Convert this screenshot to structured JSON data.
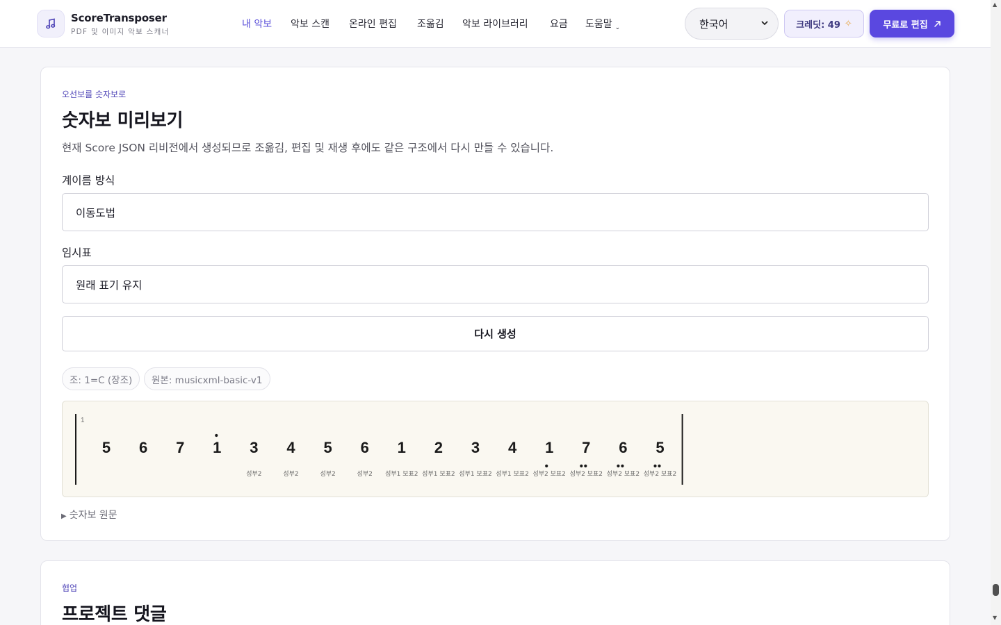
{
  "header": {
    "brand_name": "ScoreTransposer",
    "brand_sub": "PDF 및 이미지 악보 스캐너",
    "nav": [
      {
        "label": "내 악보",
        "active": true
      },
      {
        "label": "악보 스캔",
        "active": false
      },
      {
        "label": "온라인 편집",
        "active": false
      },
      {
        "label": "조옮김",
        "active": false
      },
      {
        "label": "악보 라이브러리",
        "active": false
      },
      {
        "label": "요금",
        "active": false
      },
      {
        "label": "도움말",
        "active": false
      }
    ],
    "language": "한국어",
    "credits_label": "크레딧: 49",
    "cta_label": "무료로 편집"
  },
  "preview": {
    "eyebrow": "오선보를 숫자보로",
    "title": "숫자보 미리보기",
    "description": "현재 Score JSON 리비전에서 생성되므로 조옮김, 편집 및 재생 후에도 같은 구조에서 다시 만들 수 있습니다.",
    "solfege_label": "계이름 방식",
    "solfege_value": "이동도법",
    "accidental_label": "임시표",
    "accidental_value": "원래 표기 유지",
    "regenerate_label": "다시 생성",
    "key_chip": "조: 1=C (장조)",
    "source_chip": "원본: musicxml-basic-v1",
    "details_label": "숫자보 원문"
  },
  "score": {
    "measure_number": "1",
    "notes": [
      {
        "digit": "5",
        "lyric": "",
        "dots_above": 0,
        "dots_below": 0
      },
      {
        "digit": "6",
        "lyric": "",
        "dots_above": 0,
        "dots_below": 0
      },
      {
        "digit": "7",
        "lyric": "",
        "dots_above": 0,
        "dots_below": 0
      },
      {
        "digit": "1",
        "lyric": "",
        "dots_above": 1,
        "dots_below": 0
      },
      {
        "digit": "3",
        "lyric": "성부2",
        "dots_above": 0,
        "dots_below": 0
      },
      {
        "digit": "4",
        "lyric": "성부2",
        "dots_above": 0,
        "dots_below": 0
      },
      {
        "digit": "5",
        "lyric": "성부2",
        "dots_above": 0,
        "dots_below": 0
      },
      {
        "digit": "6",
        "lyric": "성부2",
        "dots_above": 0,
        "dots_below": 0
      },
      {
        "digit": "1",
        "lyric": "성부1 보표2",
        "dots_above": 0,
        "dots_below": 0
      },
      {
        "digit": "2",
        "lyric": "성부1 보표2",
        "dots_above": 0,
        "dots_below": 0
      },
      {
        "digit": "3",
        "lyric": "성부1 보표2",
        "dots_above": 0,
        "dots_below": 0
      },
      {
        "digit": "4",
        "lyric": "성부1 보표2",
        "dots_above": 0,
        "dots_below": 0
      },
      {
        "digit": "1",
        "lyric": "성부2 보표2",
        "dots_above": 0,
        "dots_below": 1
      },
      {
        "digit": "7",
        "lyric": "성부2 보표2",
        "dots_above": 0,
        "dots_below": 2
      },
      {
        "digit": "6",
        "lyric": "성부2 보표2",
        "dots_above": 0,
        "dots_below": 2
      },
      {
        "digit": "5",
        "lyric": "성부2 보표2",
        "dots_above": 0,
        "dots_below": 2
      }
    ]
  },
  "collab": {
    "eyebrow": "협업",
    "title": "프로젝트 댓글"
  },
  "icons": {
    "logo": "music-note-icon",
    "select_chevron": "chevron-down-icon",
    "credits": "sparkle-icon",
    "cta": "arrow-up-right-icon",
    "details": "disclosure-triangle-icon"
  },
  "colors": {
    "accent": "#5a48e0",
    "active_nav": "#5a4fd9",
    "score_bg": "#faf8f1"
  }
}
